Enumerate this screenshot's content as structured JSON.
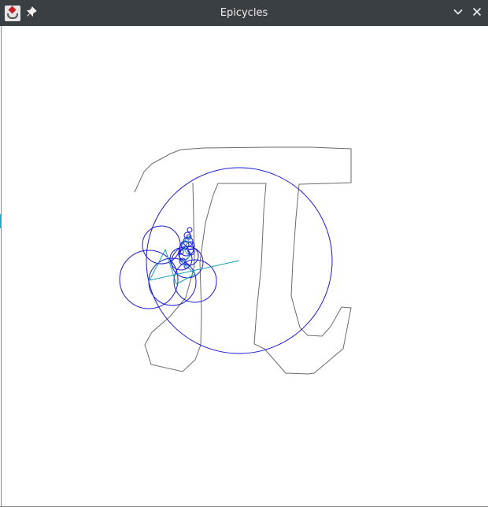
{
  "window": {
    "title": "Epicycles",
    "icons": {
      "app": "java-cup-icon",
      "pin": "pin-icon",
      "minimize": "chevron-down-icon",
      "close": "close-icon"
    },
    "glyphs": {
      "pin": "📌",
      "minimize": "⌄",
      "close": "✕"
    }
  },
  "colors": {
    "titlebar": "#3a3f44",
    "path": "#6a6a6a",
    "circles": "#1a1ad6",
    "arms": "#18a0b0",
    "canvas": "#ffffff"
  }
}
